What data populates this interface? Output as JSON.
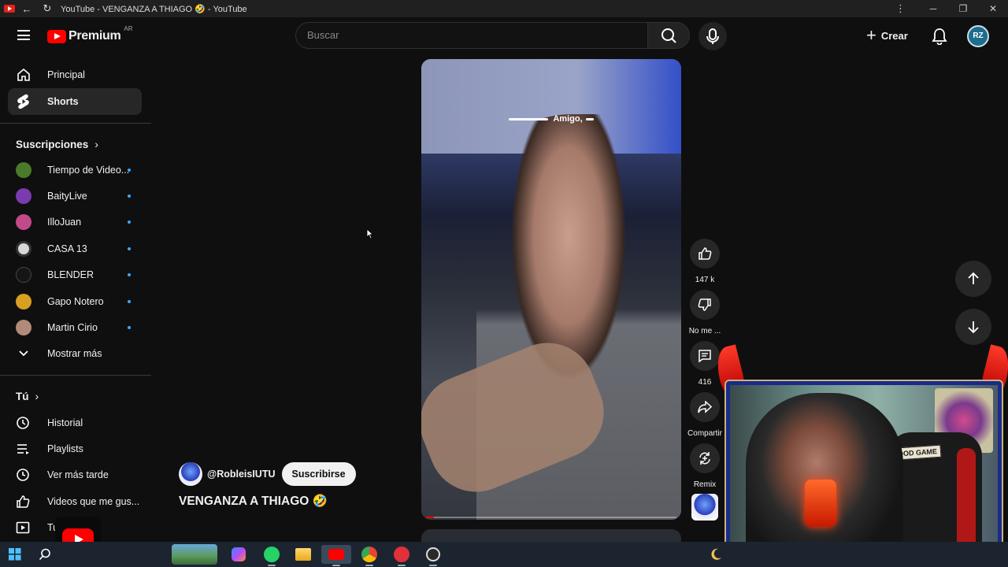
{
  "browser": {
    "tab_title": "YouTube - VENGANZA A THIAGO 🤣 - YouTube",
    "window_controls": {
      "minimize": "─",
      "restore": "❐",
      "close": "✕",
      "menu": "⋮"
    },
    "back_icon": "←",
    "reload_icon": "↻"
  },
  "header": {
    "logo_text": "Premium",
    "country": "AR",
    "search_placeholder": "Buscar",
    "create_label": "Crear",
    "create_icon": "+",
    "avatar_initials": "RZ"
  },
  "sidebar": {
    "items": [
      {
        "label": "Principal",
        "icon": "home-icon"
      },
      {
        "label": "Shorts",
        "icon": "shorts-icon"
      }
    ],
    "subscriptions_heading": "Suscripciones",
    "subscriptions": [
      {
        "label": "Tiempo de Video...",
        "color": "#4a7a2a"
      },
      {
        "label": "BaityLive",
        "color": "#7a3ab0"
      },
      {
        "label": "IlloJuan",
        "color": "#c24a8a"
      },
      {
        "label": "CASA 13",
        "color": "#d8d8d8"
      },
      {
        "label": "BLENDER",
        "color": "#151515"
      },
      {
        "label": "Gapo Notero",
        "color": "#d8a020"
      },
      {
        "label": "Martin Cirio",
        "color": "#b08a7a"
      }
    ],
    "show_more": "Mostrar más",
    "you_heading": "Tú",
    "you_items": [
      {
        "label": "Historial",
        "icon": "history-icon"
      },
      {
        "label": "Playlists",
        "icon": "playlist-icon"
      },
      {
        "label": "Ver más tarde",
        "icon": "clock-icon"
      },
      {
        "label": "Videos que me gus...",
        "icon": "thumbs-up-icon"
      },
      {
        "label": "Tu",
        "icon": "your-videos-icon"
      }
    ],
    "chevron": "›"
  },
  "short": {
    "caption": "Amigo,",
    "channel": "@RobleisIUTU",
    "subscribe_label": "Suscribirse",
    "title": "VENGANZA A THIAGO 🤣",
    "progress": 0.03,
    "actions": {
      "likes": "147 k",
      "dislike": "No me ...",
      "comments": "416",
      "share": "Compartir",
      "remix": "Remix"
    }
  },
  "overlay": {
    "badge": "GOOD GAME"
  },
  "colors": {
    "accent": "#ff0000",
    "background": "#0f0f0f",
    "subscription_dot": "#3ea6ff"
  }
}
